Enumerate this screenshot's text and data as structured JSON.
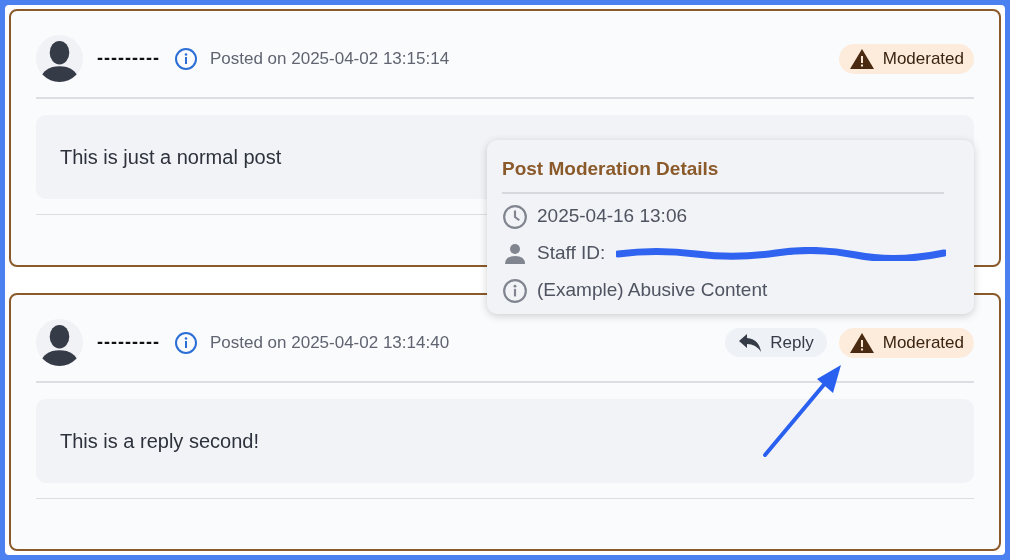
{
  "posts": [
    {
      "author": "---------",
      "posted": "Posted on 2025-04-02 13:15:14",
      "badge": "Moderated",
      "body": "This is just a normal post"
    },
    {
      "author": "---------",
      "posted": "Posted on 2025-04-02 13:14:40",
      "reply_button": "Reply",
      "badge": "Moderated",
      "body": "This is a reply second!"
    }
  ],
  "moderation_popover": {
    "title": "Post Moderation Details",
    "rows": [
      {
        "kind": "time",
        "text": "2025-04-16 13:06"
      },
      {
        "kind": "staff",
        "text": "Staff ID:",
        "redacted": true
      },
      {
        "kind": "info",
        "text": "(Example) Abusive Content"
      }
    ]
  }
}
